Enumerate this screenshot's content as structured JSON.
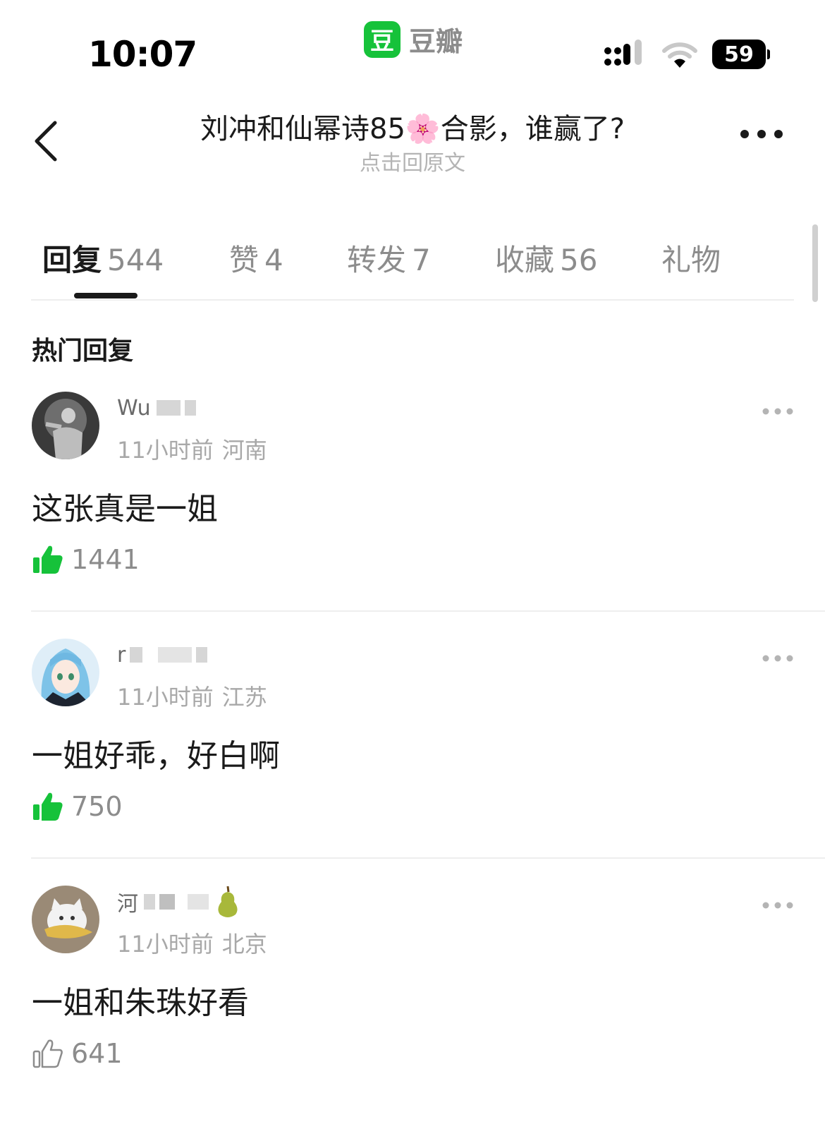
{
  "status_bar": {
    "time": "10:07",
    "app_logo_char": "豆",
    "app_name": "豆瓣",
    "battery": "59"
  },
  "header": {
    "title": "刘冲和仙幂诗85🌸合影，谁赢了?",
    "subtitle": "点击回原文"
  },
  "tabs": [
    {
      "label": "回复",
      "count": "544",
      "active": true
    },
    {
      "label": "赞",
      "count": "4"
    },
    {
      "label": "转发",
      "count": "7"
    },
    {
      "label": "收藏",
      "count": "56"
    },
    {
      "label": "礼物",
      "count": ""
    }
  ],
  "section_title": "热门回复",
  "comments": [
    {
      "username": "Wu",
      "time": "11小时前",
      "region": "河南",
      "text": "这张真是一姐",
      "likes": "1441",
      "liked": true
    },
    {
      "username": "r",
      "time": "11小时前",
      "region": "江苏",
      "text": "一姐好乖，好白啊",
      "likes": "750",
      "liked": true
    },
    {
      "username": "河",
      "time": "11小时前",
      "region": "北京",
      "text": "一姐和朱珠好看",
      "likes": "641",
      "liked": false
    }
  ],
  "colors": {
    "accent": "#16c23a",
    "text_primary": "#1a1a1a",
    "text_secondary": "#8c8c8c",
    "divider": "#eeeeee"
  }
}
